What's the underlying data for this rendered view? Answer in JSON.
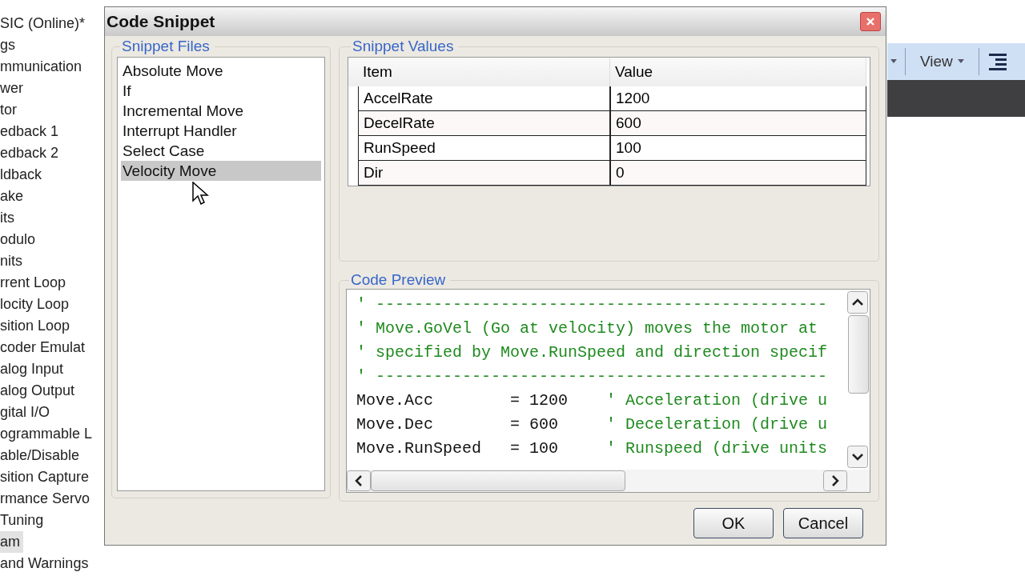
{
  "sidebar": {
    "items": [
      {
        "label": "SIC (Online)*",
        "selected": false
      },
      {
        "label": "gs",
        "selected": false
      },
      {
        "label": "mmunication",
        "selected": false
      },
      {
        "label": "wer",
        "selected": false
      },
      {
        "label": "tor",
        "selected": false
      },
      {
        "label": "edback 1",
        "selected": false
      },
      {
        "label": "edback 2",
        "selected": false
      },
      {
        "label": "ldback",
        "selected": false
      },
      {
        "label": "ake",
        "selected": false
      },
      {
        "label": "its",
        "selected": false
      },
      {
        "label": "odulo",
        "selected": false
      },
      {
        "label": "nits",
        "selected": false
      },
      {
        "label": "rrent Loop",
        "selected": false
      },
      {
        "label": "locity Loop",
        "selected": false
      },
      {
        "label": "sition Loop",
        "selected": false
      },
      {
        "label": "coder Emulat",
        "selected": false
      },
      {
        "label": "alog Input",
        "selected": false
      },
      {
        "label": "alog Output",
        "selected": false
      },
      {
        "label": "gital I/O",
        "selected": false
      },
      {
        "label": "ogrammable L",
        "selected": false
      },
      {
        "label": "able/Disable",
        "selected": false
      },
      {
        "label": "sition Capture",
        "selected": false
      },
      {
        "label": "rmance Servo",
        "selected": false
      },
      {
        "label": "Tuning",
        "selected": false
      },
      {
        "label": "am",
        "selected": true
      },
      {
        "label": "and Warnings",
        "selected": false
      }
    ]
  },
  "toolbar": {
    "view_menu": "View"
  },
  "dialog": {
    "title": "Code Snippet",
    "snippet_files": {
      "title": "Snippet Files",
      "items": [
        {
          "label": "Absolute Move",
          "selected": false
        },
        {
          "label": "If",
          "selected": false
        },
        {
          "label": "Incremental Move",
          "selected": false
        },
        {
          "label": "Interrupt Handler",
          "selected": false
        },
        {
          "label": "Select Case",
          "selected": false
        },
        {
          "label": "Velocity Move",
          "selected": true
        }
      ]
    },
    "snippet_values": {
      "title": "Snippet Values",
      "columns": [
        "Item",
        "Value"
      ],
      "rows": [
        [
          "AccelRate",
          "1200"
        ],
        [
          "DecelRate",
          "600"
        ],
        [
          "RunSpeed",
          "100"
        ],
        [
          "Dir",
          "0"
        ]
      ]
    },
    "code_preview": {
      "title": "Code Preview",
      "lines": [
        {
          "comment": "' -----------------------------------------------"
        },
        {
          "comment": "' Move.GoVel (Go at velocity) moves the motor at"
        },
        {
          "comment": "' specified by Move.RunSpeed and direction specif"
        },
        {
          "comment": "' -----------------------------------------------"
        },
        {
          "code": "Move.Acc        = 1200    ",
          "comment": "' Acceleration (drive u"
        },
        {
          "code": "Move.Dec        = 600     ",
          "comment": "' Deceleration (drive u"
        },
        {
          "code": "Move.RunSpeed   = 100     ",
          "comment": "' Runspeed (drive units"
        }
      ]
    },
    "buttons": [
      "OK",
      "Cancel"
    ]
  }
}
